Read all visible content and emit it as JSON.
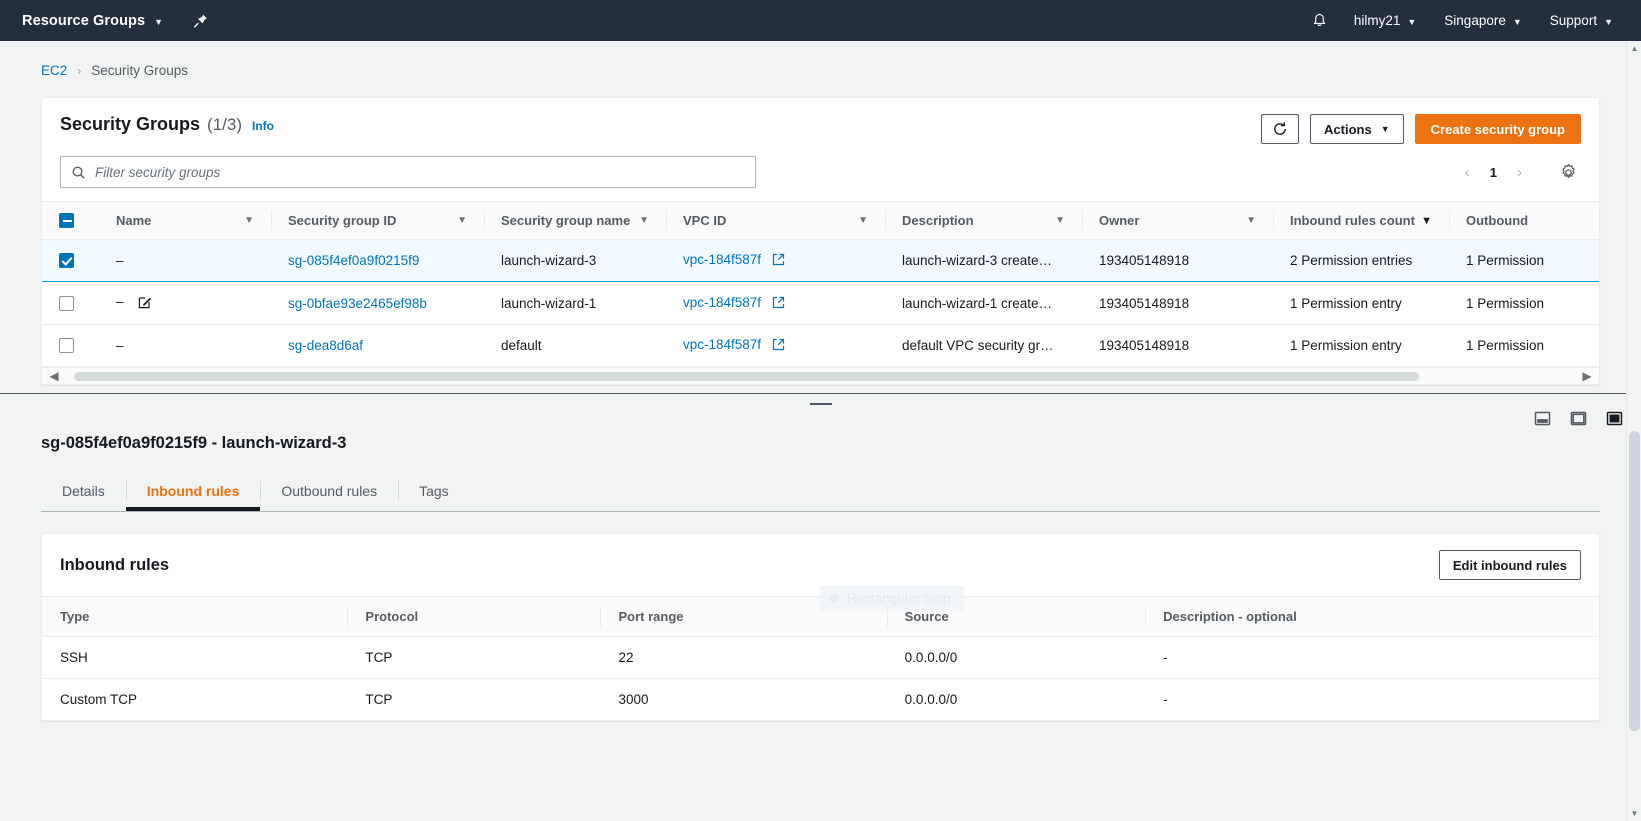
{
  "topnav": {
    "resource_groups_label": "Resource Groups",
    "pin_icon": "pin-icon",
    "bell_icon": "bell-notification-icon",
    "account_label": "hilmy21",
    "region_label": "Singapore",
    "support_label": "Support"
  },
  "breadcrumb": {
    "root": "EC2",
    "separator": "›",
    "current": "Security Groups"
  },
  "header": {
    "title": "Security Groups",
    "count": "(1/3)",
    "info_label": "Info",
    "refresh_icon": "refresh-icon",
    "actions_label": "Actions",
    "create_label": "Create security group",
    "caret": "▼"
  },
  "search": {
    "placeholder": "Filter security groups",
    "value": "",
    "icon": "search-icon"
  },
  "pagination": {
    "prev": "‹",
    "page": "1",
    "next": "›",
    "settings_icon": "gear-icon"
  },
  "table": {
    "select_all_state": "indeterminate",
    "columns": [
      {
        "label": "Name",
        "sortable": true,
        "sorted": false
      },
      {
        "label": "Security group ID",
        "sortable": true,
        "sorted": false
      },
      {
        "label": "Security group name",
        "sortable": true,
        "sorted": false
      },
      {
        "label": "VPC ID",
        "sortable": true,
        "sorted": false
      },
      {
        "label": "Description",
        "sortable": true,
        "sorted": false
      },
      {
        "label": "Owner",
        "sortable": true,
        "sorted": false
      },
      {
        "label": "Inbound rules count",
        "sortable": true,
        "sorted": true
      },
      {
        "label": "Outbound",
        "sortable": false,
        "sorted": false
      }
    ],
    "rows": [
      {
        "selected": true,
        "name": "–",
        "has_edit_icon": false,
        "group_id": "sg-085f4ef0a9f0215f9",
        "group_name": "launch-wizard-3",
        "vpc_id": "vpc-184f587f",
        "description": "launch-wizard-3 create…",
        "owner": "193405148918",
        "inbound_count": "2 Permission entries",
        "outbound_count": "1 Permission"
      },
      {
        "selected": false,
        "name": "–",
        "has_edit_icon": true,
        "group_id": "sg-0bfae93e2465ef98b",
        "group_name": "launch-wizard-1",
        "vpc_id": "vpc-184f587f",
        "description": "launch-wizard-1 create…",
        "owner": "193405148918",
        "inbound_count": "1 Permission entry",
        "outbound_count": "1 Permission"
      },
      {
        "selected": false,
        "name": "–",
        "has_edit_icon": false,
        "group_id": "sg-dea8d6af",
        "group_name": "default",
        "vpc_id": "vpc-184f587f",
        "description": "default VPC security gr…",
        "owner": "193405148918",
        "inbound_count": "1 Permission entry",
        "outbound_count": "1 Permission"
      }
    ]
  },
  "panel": {
    "title": "sg-085f4ef0a9f0215f9 - launch-wizard-3",
    "tabs": [
      {
        "label": "Details",
        "active": false
      },
      {
        "label": "Inbound rules",
        "active": true
      },
      {
        "label": "Outbound rules",
        "active": false
      },
      {
        "label": "Tags",
        "active": false
      }
    ],
    "layout_icons": [
      "panel-split-bottom-icon",
      "panel-split-side-icon",
      "panel-maximize-icon"
    ]
  },
  "inbound": {
    "title": "Inbound rules",
    "edit_label": "Edit inbound rules",
    "columns": [
      "Type",
      "Protocol",
      "Port range",
      "Source",
      "Description - optional"
    ],
    "rows": [
      {
        "type": "SSH",
        "protocol": "TCP",
        "port_range": "22",
        "source": "0.0.0.0/0",
        "description": "-"
      },
      {
        "type": "Custom TCP",
        "protocol": "TCP",
        "port_range": "3000",
        "source": "0.0.0.0/0",
        "description": "-"
      }
    ]
  },
  "overlay": {
    "snip_label": "Rectangular Snip"
  }
}
